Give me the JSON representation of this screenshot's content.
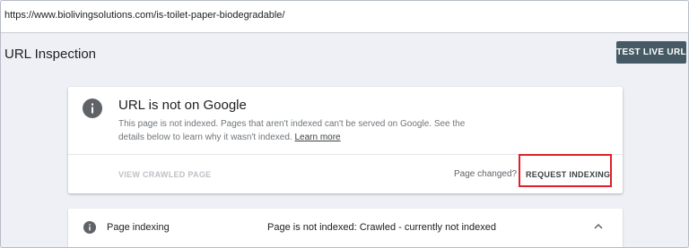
{
  "url_bar": {
    "url": "https://www.biolivingsolutions.com/is-toilet-paper-biodegradable/"
  },
  "header": {
    "title": "URL Inspection",
    "test_live_url_label": "TEST LIVE URL"
  },
  "status_card": {
    "icon": "info-icon",
    "title": "URL is not on Google",
    "description": "This page is not indexed. Pages that aren't indexed can't be served on Google. See the details below to learn why it wasn't indexed.",
    "learn_more_label": "Learn more",
    "view_crawled_label": "VIEW CRAWLED PAGE",
    "page_changed_label": "Page changed?",
    "request_indexing_label": "REQUEST INDEXING"
  },
  "indexing_card": {
    "icon": "info-icon",
    "label": "Page indexing",
    "value": "Page is not indexed: Crawled - currently not indexed",
    "expand_icon": "chevron-up-icon"
  },
  "colors": {
    "highlight": "#e0202a",
    "button_bg": "#455a64",
    "background": "#eef0f5"
  }
}
